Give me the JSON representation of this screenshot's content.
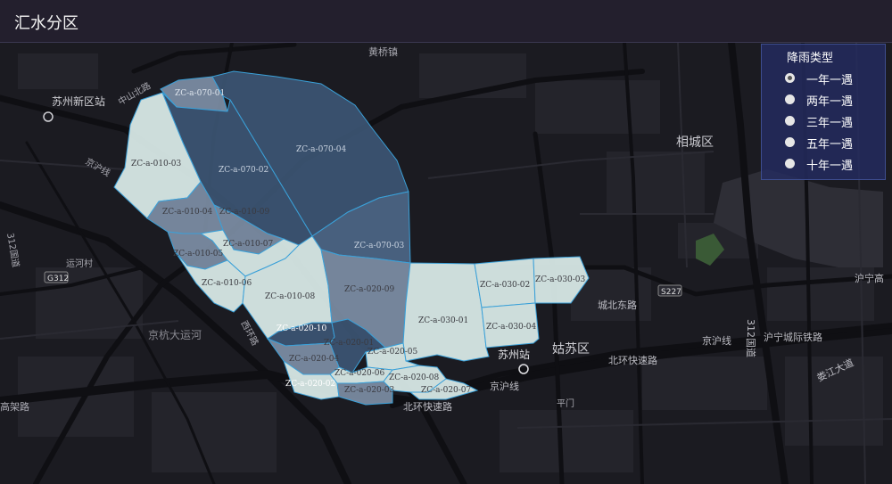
{
  "header": {
    "title": "汇水分区"
  },
  "legend": {
    "title": "降雨类型",
    "items": [
      {
        "label": "一年一遇",
        "selected": true
      },
      {
        "label": "两年一遇",
        "selected": false
      },
      {
        "label": "三年一遇",
        "selected": false
      },
      {
        "label": "五年一遇",
        "selected": false
      },
      {
        "label": "十年一遇",
        "selected": false
      }
    ]
  },
  "map": {
    "colors": {
      "level_dark": "#3d5676",
      "level_mid_dark": "#4e6888",
      "level_mid": "#7f91a9",
      "level_light": "#d4e5e3",
      "boundary": "#3aa0d8",
      "background": "#1b1b21"
    },
    "basemap_labels": {
      "suzhou_xinqu_station": "苏州新区站",
      "huangqiao": "黄桥镇",
      "xiangcheng": "相城区",
      "gusu": "姑苏区",
      "suzhou_station": "苏州站",
      "jinghang_canal": "京杭大运河",
      "yunhe_village": "运河村",
      "g312": "G312",
      "s227": "S227",
      "zhongshan_north": "中山北路",
      "chengbei_east": "城北东路",
      "beihuan_expressway": "北环快速路",
      "beihuan_expressway_2": "北环快速路",
      "jinghu_line": "京沪线",
      "jinghu_line_2": "京沪线",
      "jinghu_line_3": "京沪线",
      "huning_intercity": "沪宁城际铁路",
      "huning_high": "沪宁高",
      "loujiang": "娄江大道",
      "pingmen": "平门",
      "gaojia": "高架路",
      "road_312": "312国道",
      "road_312b": "312国道",
      "xihuan": "西环路"
    },
    "zones": [
      {
        "id": "ZC-a-070-01",
        "level": "mid"
      },
      {
        "id": "ZC-a-070-04",
        "level": "dark"
      },
      {
        "id": "ZC-a-070-02",
        "level": "dark"
      },
      {
        "id": "ZC-a-010-03",
        "level": "light"
      },
      {
        "id": "ZC-a-010-04",
        "level": "mid"
      },
      {
        "id": "ZC-a-010-09",
        "level": "mid"
      },
      {
        "id": "ZC-a-070-03",
        "level": "mid_dark"
      },
      {
        "id": "ZC-a-010-07",
        "level": "light"
      },
      {
        "id": "ZC-a-010-05",
        "level": "mid"
      },
      {
        "id": "ZC-a-010-06",
        "level": "light"
      },
      {
        "id": "ZC-a-010-08",
        "level": "light"
      },
      {
        "id": "ZC-a-020-09",
        "level": "mid"
      },
      {
        "id": "ZC-a-030-01",
        "level": "light"
      },
      {
        "id": "ZC-a-030-02",
        "level": "light"
      },
      {
        "id": "ZC-a-030-03",
        "level": "light"
      },
      {
        "id": "ZC-a-030-04",
        "level": "light"
      },
      {
        "id": "ZC-a-020-10",
        "level": "dark"
      },
      {
        "id": "ZC-a-020-01",
        "level": "dark"
      },
      {
        "id": "ZC-a-020-05",
        "level": "light"
      },
      {
        "id": "ZC-a-020-04",
        "level": "mid"
      },
      {
        "id": "ZC-a-020-06",
        "level": "light"
      },
      {
        "id": "ZC-a-020-02",
        "level": "light"
      },
      {
        "id": "ZC-a-020-03",
        "level": "mid"
      },
      {
        "id": "ZC-a-020-08",
        "level": "light"
      },
      {
        "id": "ZC-a-020-07",
        "level": "light"
      }
    ]
  }
}
